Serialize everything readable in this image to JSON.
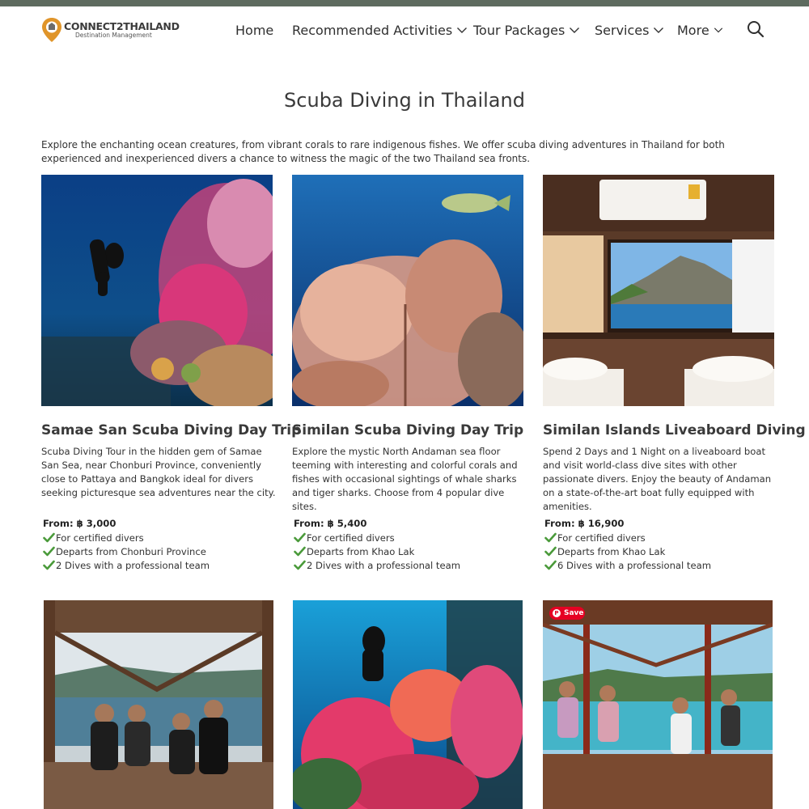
{
  "brand": {
    "name": "CONNECT2THAILAND",
    "tagline": "Destination Management",
    "primary_color": "#e0952a"
  },
  "nav": {
    "home": "Home",
    "activities": "Recommended Activities",
    "tours": "Tour Packages",
    "services": "Services",
    "more": "More",
    "search_icon": "search-icon"
  },
  "page": {
    "title": "Scuba Diving in Thailand",
    "intro": "Explore the enchanting ocean creatures, from vibrant corals to rare indigenous fishes. We offer scuba diving adventures in Thailand for both experienced and inexperienced divers a chance to witness the magic of the two Thailand sea fronts."
  },
  "cards": [
    {
      "title": "Samae San Scuba Diving Day Trip",
      "description": "Scuba Diving Tour in the hidden gem of Samae San Sea, near Chonburi Province, conveniently close to Pattaya and Bangkok ideal for divers seeking picturesque sea adventures near the city.",
      "price": "From: ฿ 3,000",
      "features": [
        "For certified divers",
        "Departs from Chonburi Province",
        "2 Dives with a professional team"
      ]
    },
    {
      "title": "Similan Scuba Diving Day Trip",
      "description": "Explore the mystic North Andaman sea floor teeming with interesting and colorful corals and fishes with occasional sightings of whale sharks and tiger sharks. Choose from 4 popular dive sites.",
      "price": "From: ฿ 5,400",
      "features": [
        "For certified divers",
        "Departs from Khao Lak",
        "2 Dives with a professional team"
      ]
    },
    {
      "title": "Similan Islands Liveaboard Diving",
      "description": "Spend 2 Days and 1 Night on a liveaboard boat and visit world-class dive sites with other passionate divers. Enjoy the beauty of Andaman on a state-of-the-art boat fully equipped with amenities.",
      "price": "From: ฿ 16,900",
      "features": [
        "For certified divers",
        "Departs from Khao Lak",
        "6 Dives with a professional team"
      ]
    }
  ],
  "pinterest": {
    "save_label": "Save"
  },
  "colors": {
    "check": "#4a9a3a",
    "topbar": "#5e6b5f"
  }
}
